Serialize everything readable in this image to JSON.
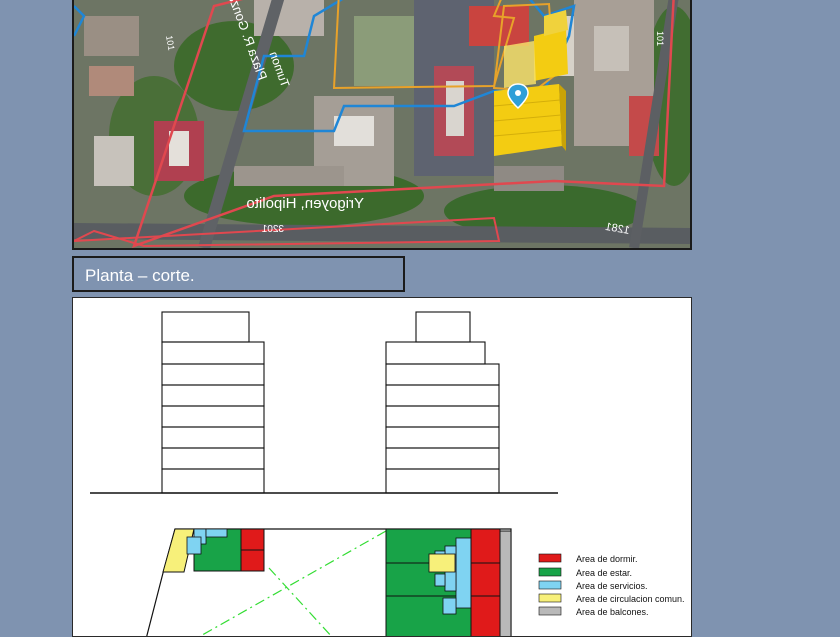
{
  "caption": "Planta – corte.",
  "aerial": {
    "street_label_1": "Yrigoyen, Hipolito",
    "street_label_2": "Plaza R. Gonzalez",
    "street_label_3": "Tumon",
    "number_label_1": "3201",
    "number_label_2": "1281",
    "number_label_3": "101",
    "number_label_4": "101",
    "pin_color": "#2f9fd8"
  },
  "legend": {
    "items": [
      {
        "label": "Area de dormir.",
        "color": "#e01a1a"
      },
      {
        "label": "Area de estar.",
        "color": "#18a348"
      },
      {
        "label": "Area de servicios.",
        "color": "#7fd3f2"
      },
      {
        "label": "Area de circulacion comun.",
        "color": "#f7f07a"
      },
      {
        "label": "Area de balcones.",
        "color": "#b9b9b9"
      }
    ]
  },
  "colors": {
    "background": "#7f93b0",
    "outline_red": "#e0484f",
    "outline_blue": "#1f86d6",
    "outline_orange": "#e8a22a",
    "volume_yellow": "#f3cc12"
  }
}
